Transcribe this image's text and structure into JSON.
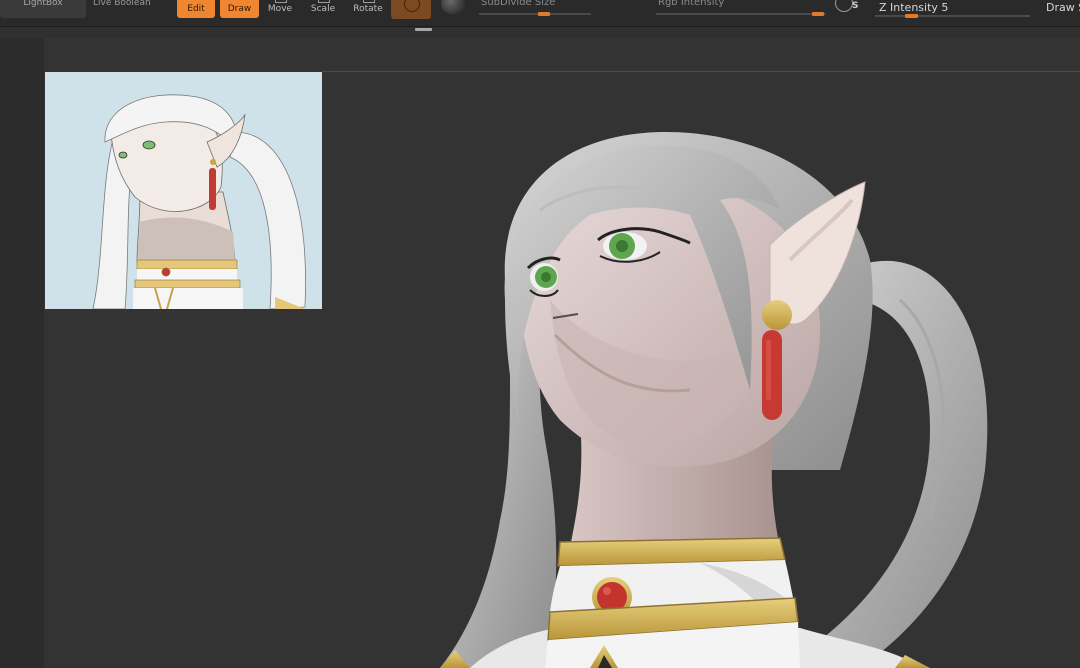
{
  "toolbar": {
    "lightbox_label": "LightBox",
    "live_boolean_label": "Live Boolean",
    "edit_label": "Edit",
    "draw_label": "Draw",
    "move_label": "Move",
    "scale_label": "Scale",
    "rotate_label": "Rotate",
    "subdivide_size_label": "SubDivide Size",
    "rgb_intensity_label": "Rgb Intensity",
    "s_label": "S",
    "z_intensity_label": "Z Intensity 5",
    "draw_size_label": "Draw S"
  },
  "colors": {
    "accent": "#f0862f",
    "viewport": "#333333",
    "toolbar": "#2a2a2a"
  },
  "viewport": {
    "reference_image": "reference-illustration",
    "model": "sculpted-3d-head"
  }
}
